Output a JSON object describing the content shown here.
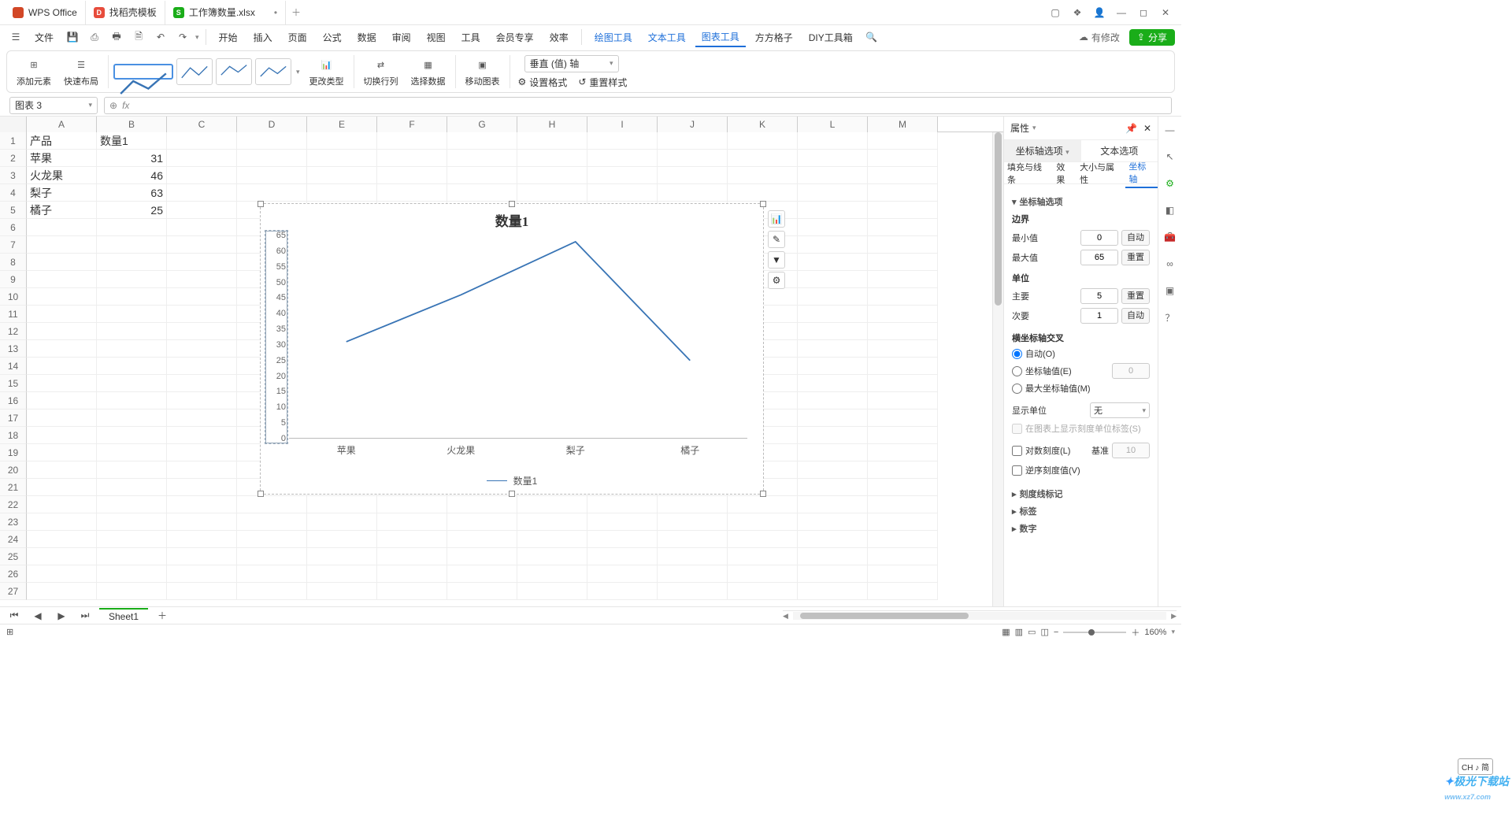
{
  "app_name": "WPS Office",
  "tabs": {
    "stock": "找稻壳模板",
    "file": "工作簿数量.xlsx"
  },
  "menubar": {
    "file": "文件",
    "items": [
      "开始",
      "插入",
      "页面",
      "公式",
      "数据",
      "审阅",
      "视图",
      "工具",
      "会员专享",
      "效率"
    ],
    "tool_items": [
      "绘图工具",
      "文本工具",
      "图表工具",
      "方方格子",
      "DIY工具箱"
    ],
    "active": "图表工具",
    "has_changes": "有修改",
    "share": "分享"
  },
  "ribbon": {
    "add_el": "添加元素",
    "quick": "快速布局",
    "change_type": "更改类型",
    "switch_rc": "切换行列",
    "select_data": "选择数据",
    "move_chart": "移动图表",
    "set_fmt": "设置格式",
    "reset_style": "重置样式",
    "axis_select": "垂直 (值) 轴"
  },
  "namebox": "图表 3",
  "columns": [
    "A",
    "B",
    "C",
    "D",
    "E",
    "F",
    "G",
    "H",
    "I",
    "J",
    "K",
    "L",
    "M"
  ],
  "rows": 27,
  "cells": {
    "A1": "产品",
    "B1": "数量1",
    "A2": "苹果",
    "B2": "31",
    "A3": "火龙果",
    "B3": "46",
    "A4": "梨子",
    "B4": "63",
    "A5": "橘子",
    "B5": "25"
  },
  "chart_data": {
    "type": "line",
    "title": "数量1",
    "categories": [
      "苹果",
      "火龙果",
      "梨子",
      "橘子"
    ],
    "series": [
      {
        "name": "数量1",
        "values": [
          31,
          46,
          63,
          25
        ]
      }
    ],
    "ylim": [
      0,
      65
    ],
    "ystep": 5,
    "xlabel": "",
    "ylabel": ""
  },
  "panel": {
    "title": "属性",
    "tab_axis": "坐标轴选项",
    "tab_text": "文本选项",
    "sub": {
      "fill": "填充与线条",
      "effect": "效果",
      "size": "大小与属性",
      "axis": "坐标轴"
    },
    "sect_axis_opt": "坐标轴选项",
    "bounds": "边界",
    "min": "最小值",
    "max": "最大值",
    "units": "单位",
    "major": "主要",
    "minor": "次要",
    "hcross": "横坐标轴交叉",
    "cross_auto": "自动(O)",
    "cross_val": "坐标轴值(E)",
    "cross_max": "最大坐标轴值(M)",
    "disp_unit": "显示单位",
    "none": "无",
    "disp_lbl": "在图表上显示刻度单位标签(S)",
    "log": "对数刻度(L)",
    "base": "基准",
    "rev": "逆序刻度值(V)",
    "tick": "刻度线标记",
    "label": "标签",
    "number": "数字",
    "auto": "自动",
    "reset": "重置",
    "min_v": "0",
    "max_v": "65",
    "major_v": "5",
    "minor_v": "1",
    "cross_v": "0",
    "base_v": "10"
  },
  "sheettab": "Sheet1",
  "zoom": "160%",
  "ime": "CH ♪ 简",
  "watermark": "极光下载站",
  "watermark_url": "www.xz7.com"
}
